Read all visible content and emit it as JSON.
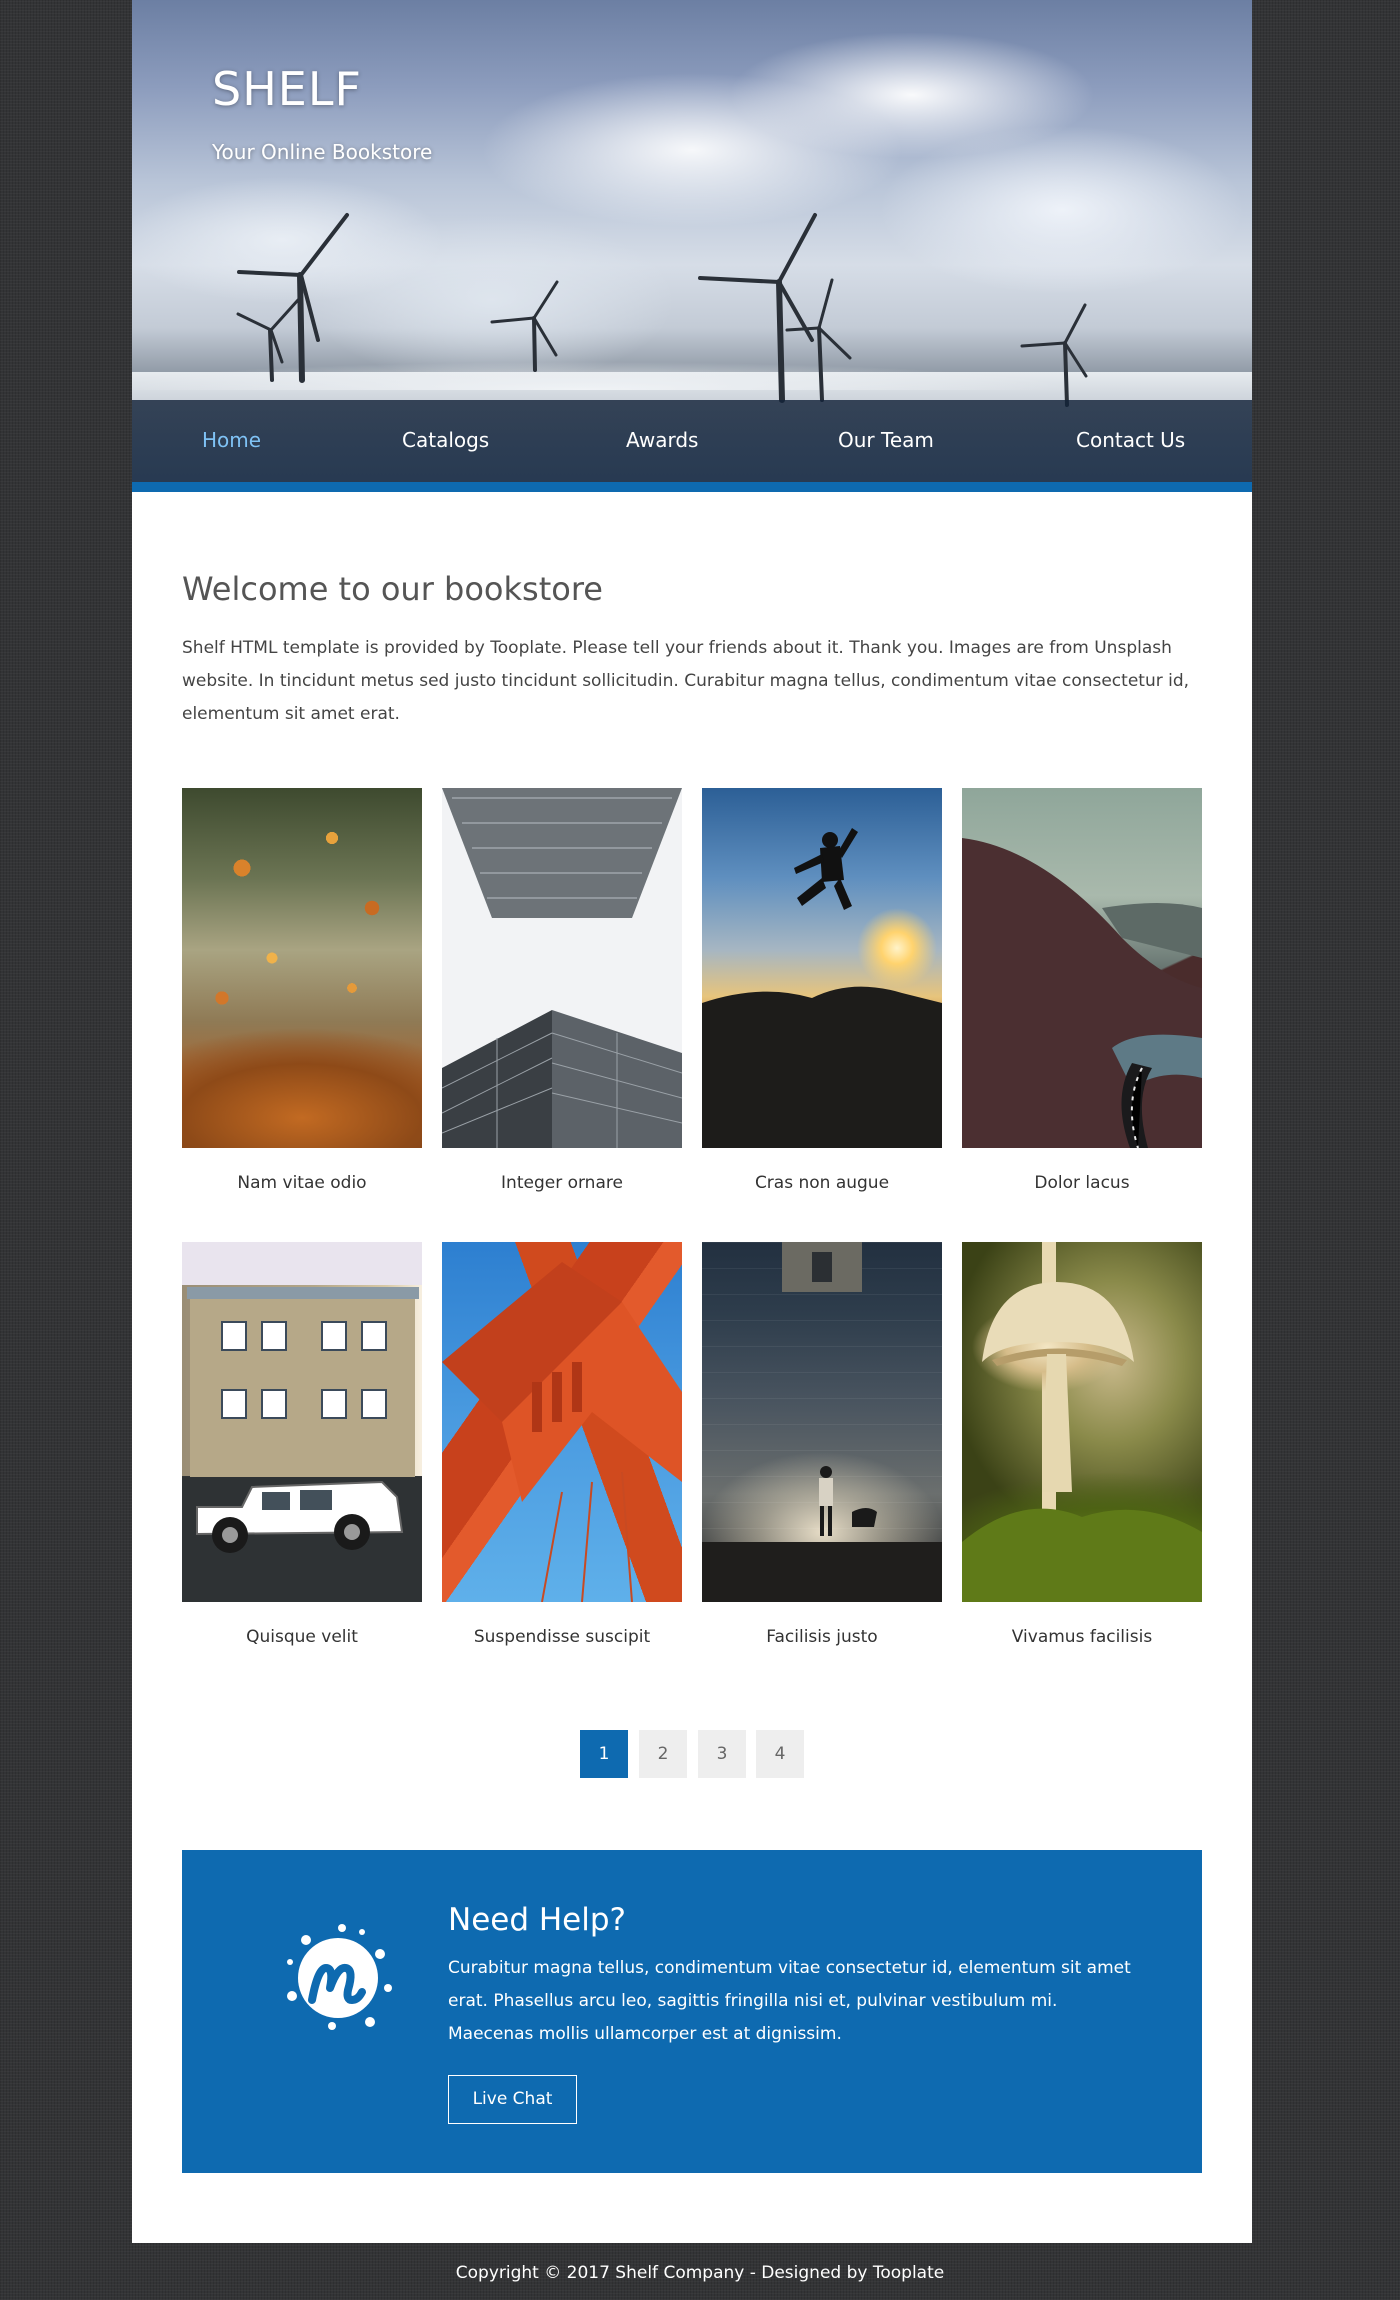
{
  "header": {
    "brand_title": "SHELF",
    "tagline": "Your Online Bookstore"
  },
  "nav": {
    "items": [
      {
        "label": "Home",
        "active": true
      },
      {
        "label": "Catalogs",
        "active": false
      },
      {
        "label": "Awards",
        "active": false
      },
      {
        "label": "Our Team",
        "active": false
      },
      {
        "label": "Contact Us",
        "active": false
      }
    ]
  },
  "welcome": {
    "title": "Welcome to our bookstore",
    "text": "Shelf HTML template is provided by Tooplate. Please tell your friends about it. Thank you. Images are from Unsplash website. In tincidunt metus sed justo tincidunt sollicitudin. Curabitur magna tellus, condimentum vitae consectetur id, elementum sit amet erat."
  },
  "gallery": {
    "items": [
      {
        "caption": "Nam vitae odio",
        "image": "autumn-leaves"
      },
      {
        "caption": "Integer ornare",
        "image": "skyscrapers"
      },
      {
        "caption": "Cras non augue",
        "image": "jumping-sunset"
      },
      {
        "caption": "Dolor lacus",
        "image": "mountain-road"
      },
      {
        "caption": "Quisque velit",
        "image": "house-and-car"
      },
      {
        "caption": "Suspendisse suscipit",
        "image": "red-bridge"
      },
      {
        "caption": "Facilisis justo",
        "image": "wall-and-dog"
      },
      {
        "caption": "Vivamus facilisis",
        "image": "mushroom"
      }
    ]
  },
  "pagination": {
    "pages": [
      "1",
      "2",
      "3",
      "4"
    ],
    "current": "1"
  },
  "help": {
    "title": "Need Help?",
    "text": "Curabitur magna tellus, condimentum vitae consectetur id, elementum sit amet erat. Phasellus arcu leo, sagittis fringilla nisi et, pulvinar vestibulum mi. Maecenas mollis ullamcorper est at dignissim.",
    "button_label": "Live Chat",
    "logo_icon": "meetup-m-icon"
  },
  "footer": {
    "text": "Copyright © 2017 Shelf Company - Designed by Tooplate"
  },
  "colors": {
    "accent": "#0e6ab0",
    "nav_active": "#7fc2f5",
    "page_background": "#333436"
  }
}
